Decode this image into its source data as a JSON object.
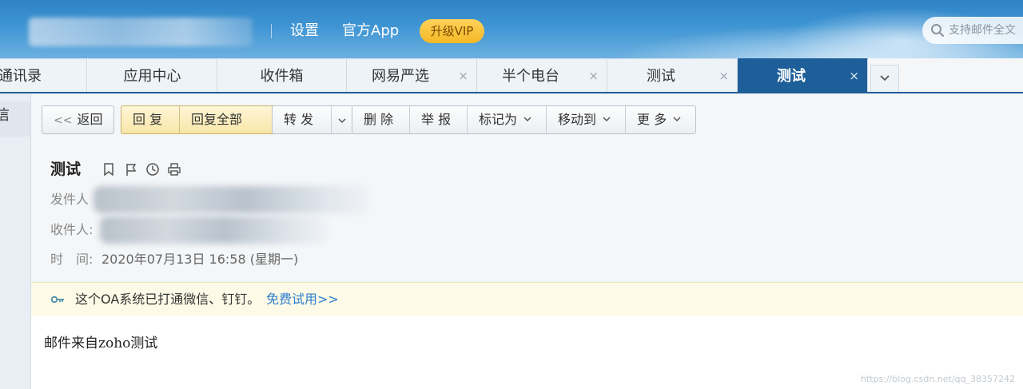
{
  "header": {
    "settings_label": "设置",
    "app_label": "官方App",
    "vip_label": "升级VIP",
    "search_placeholder": "支持邮件全文"
  },
  "tabs": [
    {
      "label": "通讯录",
      "closable": false
    },
    {
      "label": "应用中心",
      "closable": false
    },
    {
      "label": "收件箱",
      "closable": false
    },
    {
      "label": "网易严选",
      "closable": true
    },
    {
      "label": "半个电台",
      "closable": true
    },
    {
      "label": "测试",
      "closable": true
    },
    {
      "label": "测试",
      "closable": true,
      "active": true
    }
  ],
  "tab_close_glyph": "×",
  "left_nav": {
    "partial_label": "信"
  },
  "toolbar": {
    "back_label": "返回",
    "reply_label": "回 复",
    "reply_all_label": "回复全部",
    "forward_label": "转 发",
    "delete_label": "删 除",
    "report_label": "举 报",
    "mark_label": "标记为",
    "move_label": "移动到",
    "more_label": "更 多"
  },
  "mail": {
    "subject": "测试",
    "sender_label": "发件人",
    "recipient_label": "收件人:",
    "time_label": "时　间:",
    "time_value": "2020年07月13日 16:58 (星期一)",
    "body": "邮件来自zoho测试"
  },
  "notice": {
    "text": "这个OA系统已打通微信、钉钉。",
    "link": "免费试用>>"
  },
  "watermark": "https://blog.csdn.net/qq_38357242",
  "colors": {
    "header_blue": "#2f83c6",
    "active_tab": "#1f5f99",
    "vip_yellow": "#f4b826",
    "link_blue": "#2f7ecf",
    "notice_bg": "#fdfbe7"
  }
}
